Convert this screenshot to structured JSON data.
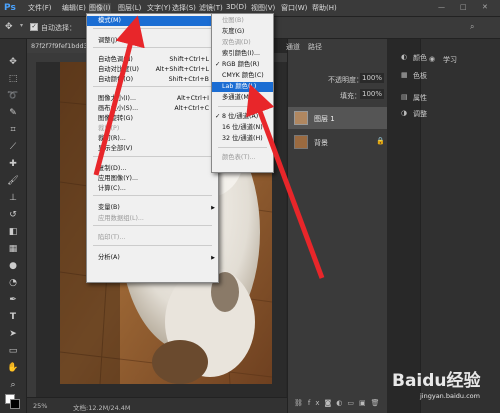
{
  "menubar": {
    "items": [
      "文件(F)",
      "编辑(E)",
      "图像(I)",
      "图层(L)",
      "文字(Y)",
      "选择(S)",
      "滤镜(T)",
      "3D(D)",
      "视图(V)",
      "窗口(W)",
      "帮助(H)"
    ]
  },
  "options": {
    "auto_select": "自动选择："
  },
  "document": {
    "tab": "87f2f7f9fef1bdd3...",
    "zoom": "25%",
    "doc_size": "文档:12.2M/24.4M"
  },
  "image_menu": {
    "items": [
      {
        "label": "模式(M)",
        "shortcut": "",
        "submenu": true,
        "highlighted": true,
        "disabled": false
      },
      {
        "label": "调整(J)",
        "shortcut": "",
        "submenu": true,
        "highlighted": false,
        "disabled": false
      },
      {
        "label": "自动色调(N)",
        "shortcut": "Shift+Ctrl+L",
        "submenu": false,
        "highlighted": false,
        "disabled": false
      },
      {
        "label": "自动对比度(U)",
        "shortcut": "Alt+Shift+Ctrl+L",
        "submenu": false,
        "highlighted": false,
        "disabled": false
      },
      {
        "label": "自动颜色(O)",
        "shortcut": "Shift+Ctrl+B",
        "submenu": false,
        "highlighted": false,
        "disabled": false
      },
      {
        "label": "图像大小(I)...",
        "shortcut": "Alt+Ctrl+I",
        "submenu": false,
        "highlighted": false,
        "disabled": false
      },
      {
        "label": "画布大小(S)...",
        "shortcut": "Alt+Ctrl+C",
        "submenu": false,
        "highlighted": false,
        "disabled": false
      },
      {
        "label": "图像旋转(G)",
        "shortcut": "",
        "submenu": true,
        "highlighted": false,
        "disabled": false
      },
      {
        "label": "裁剪(P)",
        "shortcut": "",
        "submenu": false,
        "highlighted": false,
        "disabled": true
      },
      {
        "label": "裁切(R)...",
        "shortcut": "",
        "submenu": false,
        "highlighted": false,
        "disabled": false
      },
      {
        "label": "显示全部(V)",
        "shortcut": "",
        "submenu": false,
        "highlighted": false,
        "disabled": false
      },
      {
        "label": "复制(D)...",
        "shortcut": "",
        "submenu": false,
        "highlighted": false,
        "disabled": false
      },
      {
        "label": "应用图像(Y)...",
        "shortcut": "",
        "submenu": false,
        "highlighted": false,
        "disabled": false
      },
      {
        "label": "计算(C)...",
        "shortcut": "",
        "submenu": false,
        "highlighted": false,
        "disabled": false
      },
      {
        "label": "变量(B)",
        "shortcut": "",
        "submenu": true,
        "highlighted": false,
        "disabled": false
      },
      {
        "label": "应用数据组(L)...",
        "shortcut": "",
        "submenu": false,
        "highlighted": false,
        "disabled": true
      },
      {
        "label": "陷印(T)...",
        "shortcut": "",
        "submenu": false,
        "highlighted": false,
        "disabled": true
      },
      {
        "label": "分析(A)",
        "shortcut": "",
        "submenu": true,
        "highlighted": false,
        "disabled": false
      }
    ]
  },
  "mode_submenu": {
    "items": [
      {
        "label": "位图(B)",
        "checked": false,
        "highlighted": false,
        "disabled": true
      },
      {
        "label": "灰度(G)",
        "checked": false,
        "highlighted": false,
        "disabled": false
      },
      {
        "label": "双色调(D)",
        "checked": false,
        "highlighted": false,
        "disabled": true
      },
      {
        "label": "索引颜色(I)...",
        "checked": false,
        "highlighted": false,
        "disabled": false
      },
      {
        "label": "RGB 颜色(R)",
        "checked": true,
        "highlighted": false,
        "disabled": false
      },
      {
        "label": "CMYK 颜色(C)",
        "checked": false,
        "highlighted": false,
        "disabled": false
      },
      {
        "label": "Lab 颜色(L)",
        "checked": false,
        "highlighted": true,
        "disabled": false
      },
      {
        "label": "多通道(M)",
        "checked": false,
        "highlighted": false,
        "disabled": false
      },
      {
        "label": "8 位/通道(A)",
        "checked": true,
        "highlighted": false,
        "disabled": false
      },
      {
        "label": "16 位/通道(N)",
        "checked": false,
        "highlighted": false,
        "disabled": false
      },
      {
        "label": "32 位/通道(H)",
        "checked": false,
        "highlighted": false,
        "disabled": false
      },
      {
        "label": "颜色表(T)...",
        "checked": false,
        "highlighted": false,
        "disabled": true
      }
    ]
  },
  "layers": {
    "tabs": [
      "通道",
      "路径"
    ],
    "opacity_label": "不透明度：",
    "opacity": "100%",
    "fill_label": "填充：",
    "fill": "100%",
    "items": [
      "图层 1",
      "背景"
    ]
  },
  "right_panel": {
    "items": [
      "颜色",
      "色板",
      "属性",
      "调整",
      "学习"
    ]
  },
  "watermark": {
    "logo": "Baidu经验",
    "url": "jingyan.baidu.com"
  },
  "colors": {
    "highlight": "#1b6dd3",
    "annotation_arrow": "#e8262a",
    "menu_bg": "#f0f0f0"
  }
}
